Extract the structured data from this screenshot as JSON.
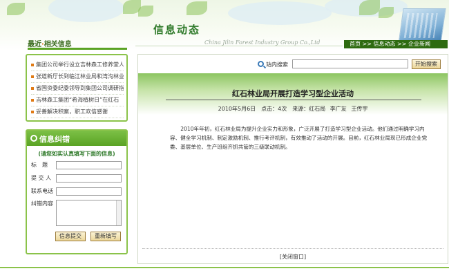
{
  "header": {
    "title": "信息动态",
    "subtitle_en": "China Jilin Forest Industry Group Co.,Ltd",
    "left_tag_prefix": "最近",
    "left_tag_dot": "·",
    "left_tag_main": "相关信息",
    "breadcrumb": "首页 >> 信息动态 >> 企业新闻"
  },
  "news": {
    "items": [
      "集团公司举行设立吉林森工修养堂人",
      "张道新厅长到临江林业局和湾沟林业",
      "省国资委纪委领导到集团公司调研指",
      "吉林森工集团“希海植树日”在红石",
      "妥善解决积案，职工欢信感谢"
    ]
  },
  "feedback": {
    "title": "信息纠错",
    "note": "(请您如实认真填写下面的信息)",
    "label_title": "标　题",
    "label_submitter": "提 交 人",
    "label_phone": "联系电话",
    "label_content": "纠错内容",
    "submit": "信息提交",
    "reset": "重新填写"
  },
  "search": {
    "label": "站内搜索",
    "placeholder": "",
    "button": "开始搜索"
  },
  "article": {
    "title": "红石林业局开展打造学习型企业活动",
    "meta": "2010年5月6日　点击：4次　来源：红石局 李广友 王传宇",
    "body": "2010年年初，红石林业局为提升企业实力和形象，广泛开展了打造学习型企业活动。他们通过明确学习内容、健全学习机制、制定激励机制、推行考评机制，有效推动了活动的开展。目前，红石林业局现已形成企业党委、基层单位、生产班组齐抓共管的三级联动机制。",
    "close": "[关闭窗口]"
  }
}
